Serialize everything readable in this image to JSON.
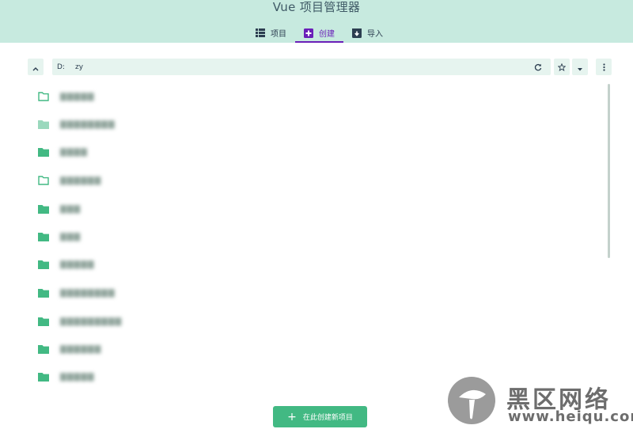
{
  "app": {
    "title": "Vue 项目管理器"
  },
  "tabs": [
    {
      "label": "项目",
      "icon": "list-icon",
      "active": false
    },
    {
      "label": "创建",
      "icon": "add-box-icon",
      "active": true
    },
    {
      "label": "导入",
      "icon": "import-icon",
      "active": false
    }
  ],
  "toolbar": {
    "path_segments": [
      "D:",
      "zy"
    ],
    "icons": [
      "chevron-up-icon",
      "edit-icon",
      "refresh-icon",
      "star-icon",
      "caret-down-icon",
      "more-vert-icon"
    ]
  },
  "folders": [
    {
      "name": "▇▇▇▇▇",
      "icon_style": "outline"
    },
    {
      "name": "▇▇▇▇▇▇▇▇",
      "icon_style": "filled-light"
    },
    {
      "name": "▇▇▇▇",
      "icon_style": "filled"
    },
    {
      "name": "▇▇▇▇▇▇",
      "icon_style": "outline"
    },
    {
      "name": "▇▇▇",
      "icon_style": "filled"
    },
    {
      "name": "▇▇▇",
      "icon_style": "filled"
    },
    {
      "name": "▇▇▇▇▇",
      "icon_style": "filled"
    },
    {
      "name": "▇▇▇▇▇▇▇▇",
      "icon_style": "filled"
    },
    {
      "name": "▇▇▇▇▇▇▇▇▇",
      "icon_style": "filled"
    },
    {
      "name": "▇▇▇▇▇▇",
      "icon_style": "filled"
    },
    {
      "name": "▇▇▇▇▇",
      "icon_style": "filled"
    }
  ],
  "create_button": {
    "label": "在此创建新项目",
    "icon": "plus-icon"
  },
  "watermark": {
    "title": "黑区网络",
    "url": "www.heiqu.com"
  },
  "colors": {
    "header_bg": "#c7eadf",
    "accent": "#42b983",
    "active_tab": "#6a1fb8",
    "bar_bg": "#e6f4ef"
  }
}
